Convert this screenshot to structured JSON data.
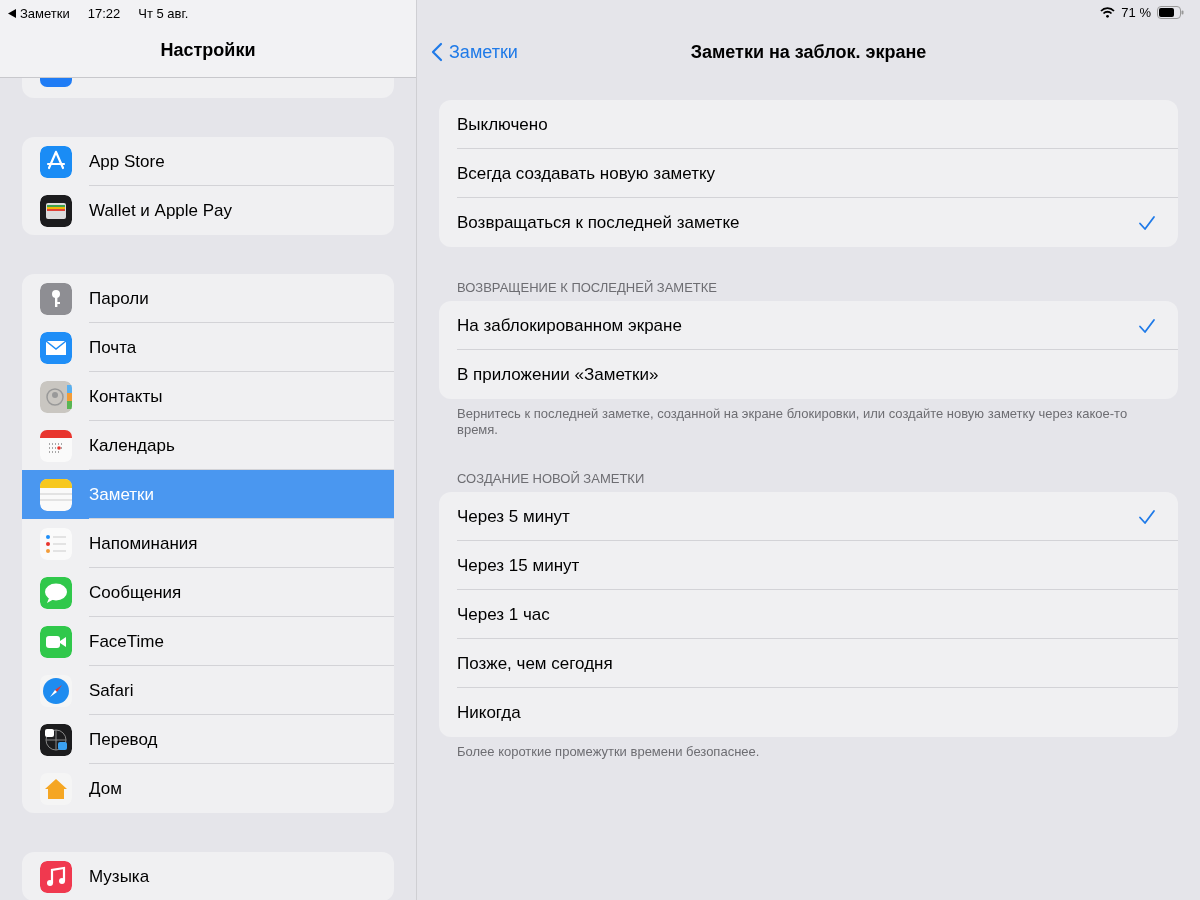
{
  "status_bar": {
    "back_app": "Заметки",
    "time": "17:22",
    "date": "Чт 5 авг.",
    "battery": "71 %"
  },
  "sidebar": {
    "title": "Настройки",
    "groups": [
      {
        "items": [
          {
            "label": "App Store",
            "selected": false
          },
          {
            "label": "Wallet и Apple Pay",
            "selected": false
          }
        ]
      },
      {
        "items": [
          {
            "label": "Пароли",
            "selected": false
          },
          {
            "label": "Почта",
            "selected": false
          },
          {
            "label": "Контакты",
            "selected": false
          },
          {
            "label": "Календарь",
            "selected": false
          },
          {
            "label": "Заметки",
            "selected": true
          },
          {
            "label": "Напоминания",
            "selected": false
          },
          {
            "label": "Сообщения",
            "selected": false
          },
          {
            "label": "FaceTime",
            "selected": false
          },
          {
            "label": "Safari",
            "selected": false
          },
          {
            "label": "Перевод",
            "selected": false
          },
          {
            "label": "Дом",
            "selected": false
          }
        ]
      },
      {
        "items": [
          {
            "label": "Музыка",
            "selected": false
          }
        ]
      }
    ]
  },
  "detail": {
    "back": "Заметки",
    "title": "Заметки на заблок. экране",
    "sections": [
      {
        "options": [
          {
            "label": "Выключено",
            "selected": false
          },
          {
            "label": "Всегда создавать новую заметку",
            "selected": false
          },
          {
            "label": "Возвращаться к последней заметке",
            "selected": true
          }
        ]
      },
      {
        "header": "ВОЗВРАЩЕНИЕ К ПОСЛЕДНЕЙ ЗАМЕТКЕ",
        "options": [
          {
            "label": "На заблокированном экране",
            "selected": true
          },
          {
            "label": "В приложении «Заметки»",
            "selected": false
          }
        ],
        "footer": "Вернитесь к последней заметке, созданной на экране блокировки, или создайте новую заметку через какое-то время."
      },
      {
        "header": "СОЗДАНИЕ НОВОЙ ЗАМЕТКИ",
        "options": [
          {
            "label": "Через 5 минут",
            "selected": true
          },
          {
            "label": "Через 15 минут",
            "selected": false
          },
          {
            "label": "Через 1 час",
            "selected": false
          },
          {
            "label": "Позже, чем сегодня",
            "selected": false
          },
          {
            "label": "Никогда",
            "selected": false
          }
        ],
        "footer": "Более короткие промежутки времени безопаснее."
      }
    ]
  }
}
